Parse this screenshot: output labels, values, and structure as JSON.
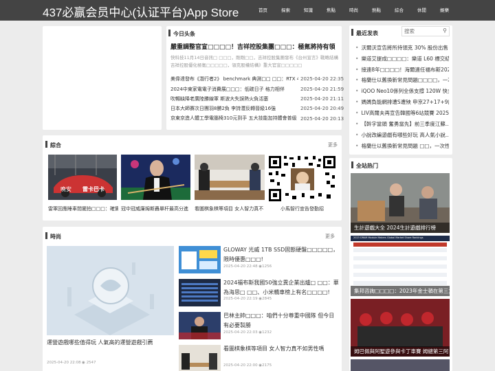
{
  "header": {
    "site_title": "437必赢会员中心(认证平台)App Store",
    "nav": [
      "首页",
      "探索",
      "知識",
      "焦點",
      "時尚",
      "熱點",
      "綜合",
      "休閒",
      "娛樂"
    ]
  },
  "headlines": {
    "heading": "今日头条",
    "top_title": "嚴重調整官宣□□□□！吉祥控股集團□□□：極氪將持有領",
    "top_summary": "快科技11月14日音訊□ □□□，剛剛□□，吉祥控股集團發布《台州宣言》戰略結構 吉祥控股優化極氪□□□□□，領克股權結構》重大官宣□□□□□",
    "items": [
      {
        "title": "美偉達發布《潛行者2》 benchmark 典測□□ □□：RTX 4...",
        "date": "2025-04-20 22:35"
      },
      {
        "title": "2024中東家電電子消費展□□□：低碳日子 格力相伴",
        "date": "2025-04-20 21:59"
      },
      {
        "title": "吹暢缺降老廣陸勝線軍 斯波大失誤熱火負活塞",
        "date": "2025-04-20 21:11"
      },
      {
        "title": "日本大師賽次日團羽8勝2負 李詩灃反轉晉級16強",
        "date": "2025-04-20 20:49"
      },
      {
        "title": "京東京造人體工學電腦椅310元到手 五大技能加持體會普級",
        "date": "2025-04-20 20:13"
      }
    ]
  },
  "latest": {
    "heading": "最近发表",
    "search_placeholder": "搜索",
    "items": [
      "沃爾沃宣告將所持領克 30% 股份出售",
      "樂道艾提成□□□□：樂道 L60 標交結...",
      "接連8年□□□□！海爾連任福布斯202...",
      "格蘭仕以舊換新常見問題□□□□，一次...",
      "iQOO Neo10係列全係支撐 120W 快充",
      "媽媽負能網排遭S遭殃 申京27+17+9爵...",
      "LIV高爾夫再宣告韓國等6站競賽 2025...",
      "【幹字當頭 奮勇當先】前三季度江蘇...",
      "小說改編遊戲有哪些好玩 高人氣小說...",
      "格蘭仕以舊換新常見問題 □□，一次性..."
    ]
  },
  "composite": {
    "heading": "綜合",
    "more": "更多",
    "cards": [
      {
        "caption": "雷軍回應睡車間擺拍□□□：確實",
        "overlay_left": "晚安",
        "overlay_right": "雷卡巴卡"
      },
      {
        "caption": "冠中冠威廉姆斯轟單杆最高分進"
      },
      {
        "caption": "看圖棋象棋等項目 女人智力真不"
      },
      {
        "caption": "小馬智行宣告發勤招"
      }
    ]
  },
  "fashion": {
    "heading": "時尚",
    "more": "更多",
    "main": {
      "title": "運營遊戲哪些值得玩 人氣高的運營遊戲引薦",
      "date": "2025-04-20 22:08",
      "views": "2547"
    },
    "items": [
      {
        "title": "GLOWAY 光威 1TB SSD固態硬盤□□□□□，限時優惠□□□!",
        "meta": "2025-04-20 22:48",
        "views": "1256"
      },
      {
        "title": "2024福布斯我國50強立異企業出爐□ □□：華為海思□ □□、小米轎車榜上有名□□□□!",
        "meta": "2025-04-20 22:19",
        "views": "2845"
      },
      {
        "title": "巴林主帥□□□：咱們十分尊重中國隊 但今日有必要製勝",
        "meta": "2025-04-20 22:03",
        "views": "1232"
      },
      {
        "title": "看圖棋象棋等項目 女人智力真不如男性嗎",
        "meta": "2025-04-20 22:00",
        "views": "2175"
      }
    ]
  },
  "hot": {
    "heading": "全站热门",
    "items": [
      {
        "caption": "生計遊戲大全 2024生計遊戲排行榜"
      },
      {
        "caption": "集邦咨詢□□□□：2023年金士頓在第三方",
        "table_title": "2023 DRAM Module Makers Global Market Share Rankings"
      },
      {
        "caption": "姆巴佩與阿聖遊參與卡丁車賽 姆總第三阿"
      }
    ]
  },
  "colors": {
    "topbar": "#444444",
    "page_bg": "#ececec",
    "panel_bg": "#ffffff"
  }
}
